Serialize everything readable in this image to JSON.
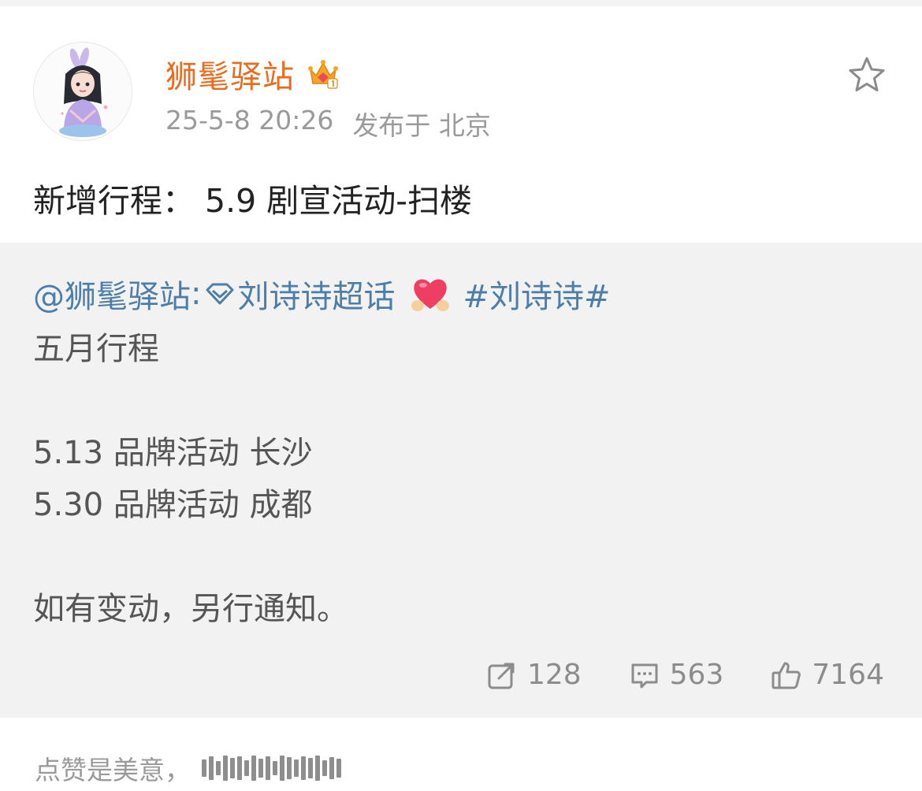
{
  "post": {
    "username": "狮髦驿站",
    "date": "25-5-8 20:26",
    "publish_location": "发布于 北京",
    "text": "新增行程：  5.9 剧宣活动-扫楼"
  },
  "repost": {
    "mention": "@狮髦驿站",
    "colon": ":",
    "supertopic": "刘诗诗超话",
    "hashtag": "#刘诗诗#",
    "line_title": "五月行程",
    "line_item1": "5.13 品牌活动 长沙",
    "line_item2": "5.30 品牌活动 成都",
    "line_note": "如有变动，另行通知。"
  },
  "actions": {
    "repost_count": "128",
    "comment_count": "563",
    "like_count": "7164"
  },
  "comment": {
    "prefix": "点赞是美意，"
  },
  "colors": {
    "username": "#e86b1e",
    "link": "#4e7ea8",
    "meta": "#9a9a9a",
    "repost_bg": "#f2f2f2"
  },
  "icons": {
    "favorite": "star-icon",
    "vip": "crown-badge-icon",
    "supertopic": "diamond-icon",
    "emoji": "heart-hands-icon",
    "repost": "share-icon",
    "comment": "comment-icon",
    "like": "thumbs-up-icon"
  }
}
